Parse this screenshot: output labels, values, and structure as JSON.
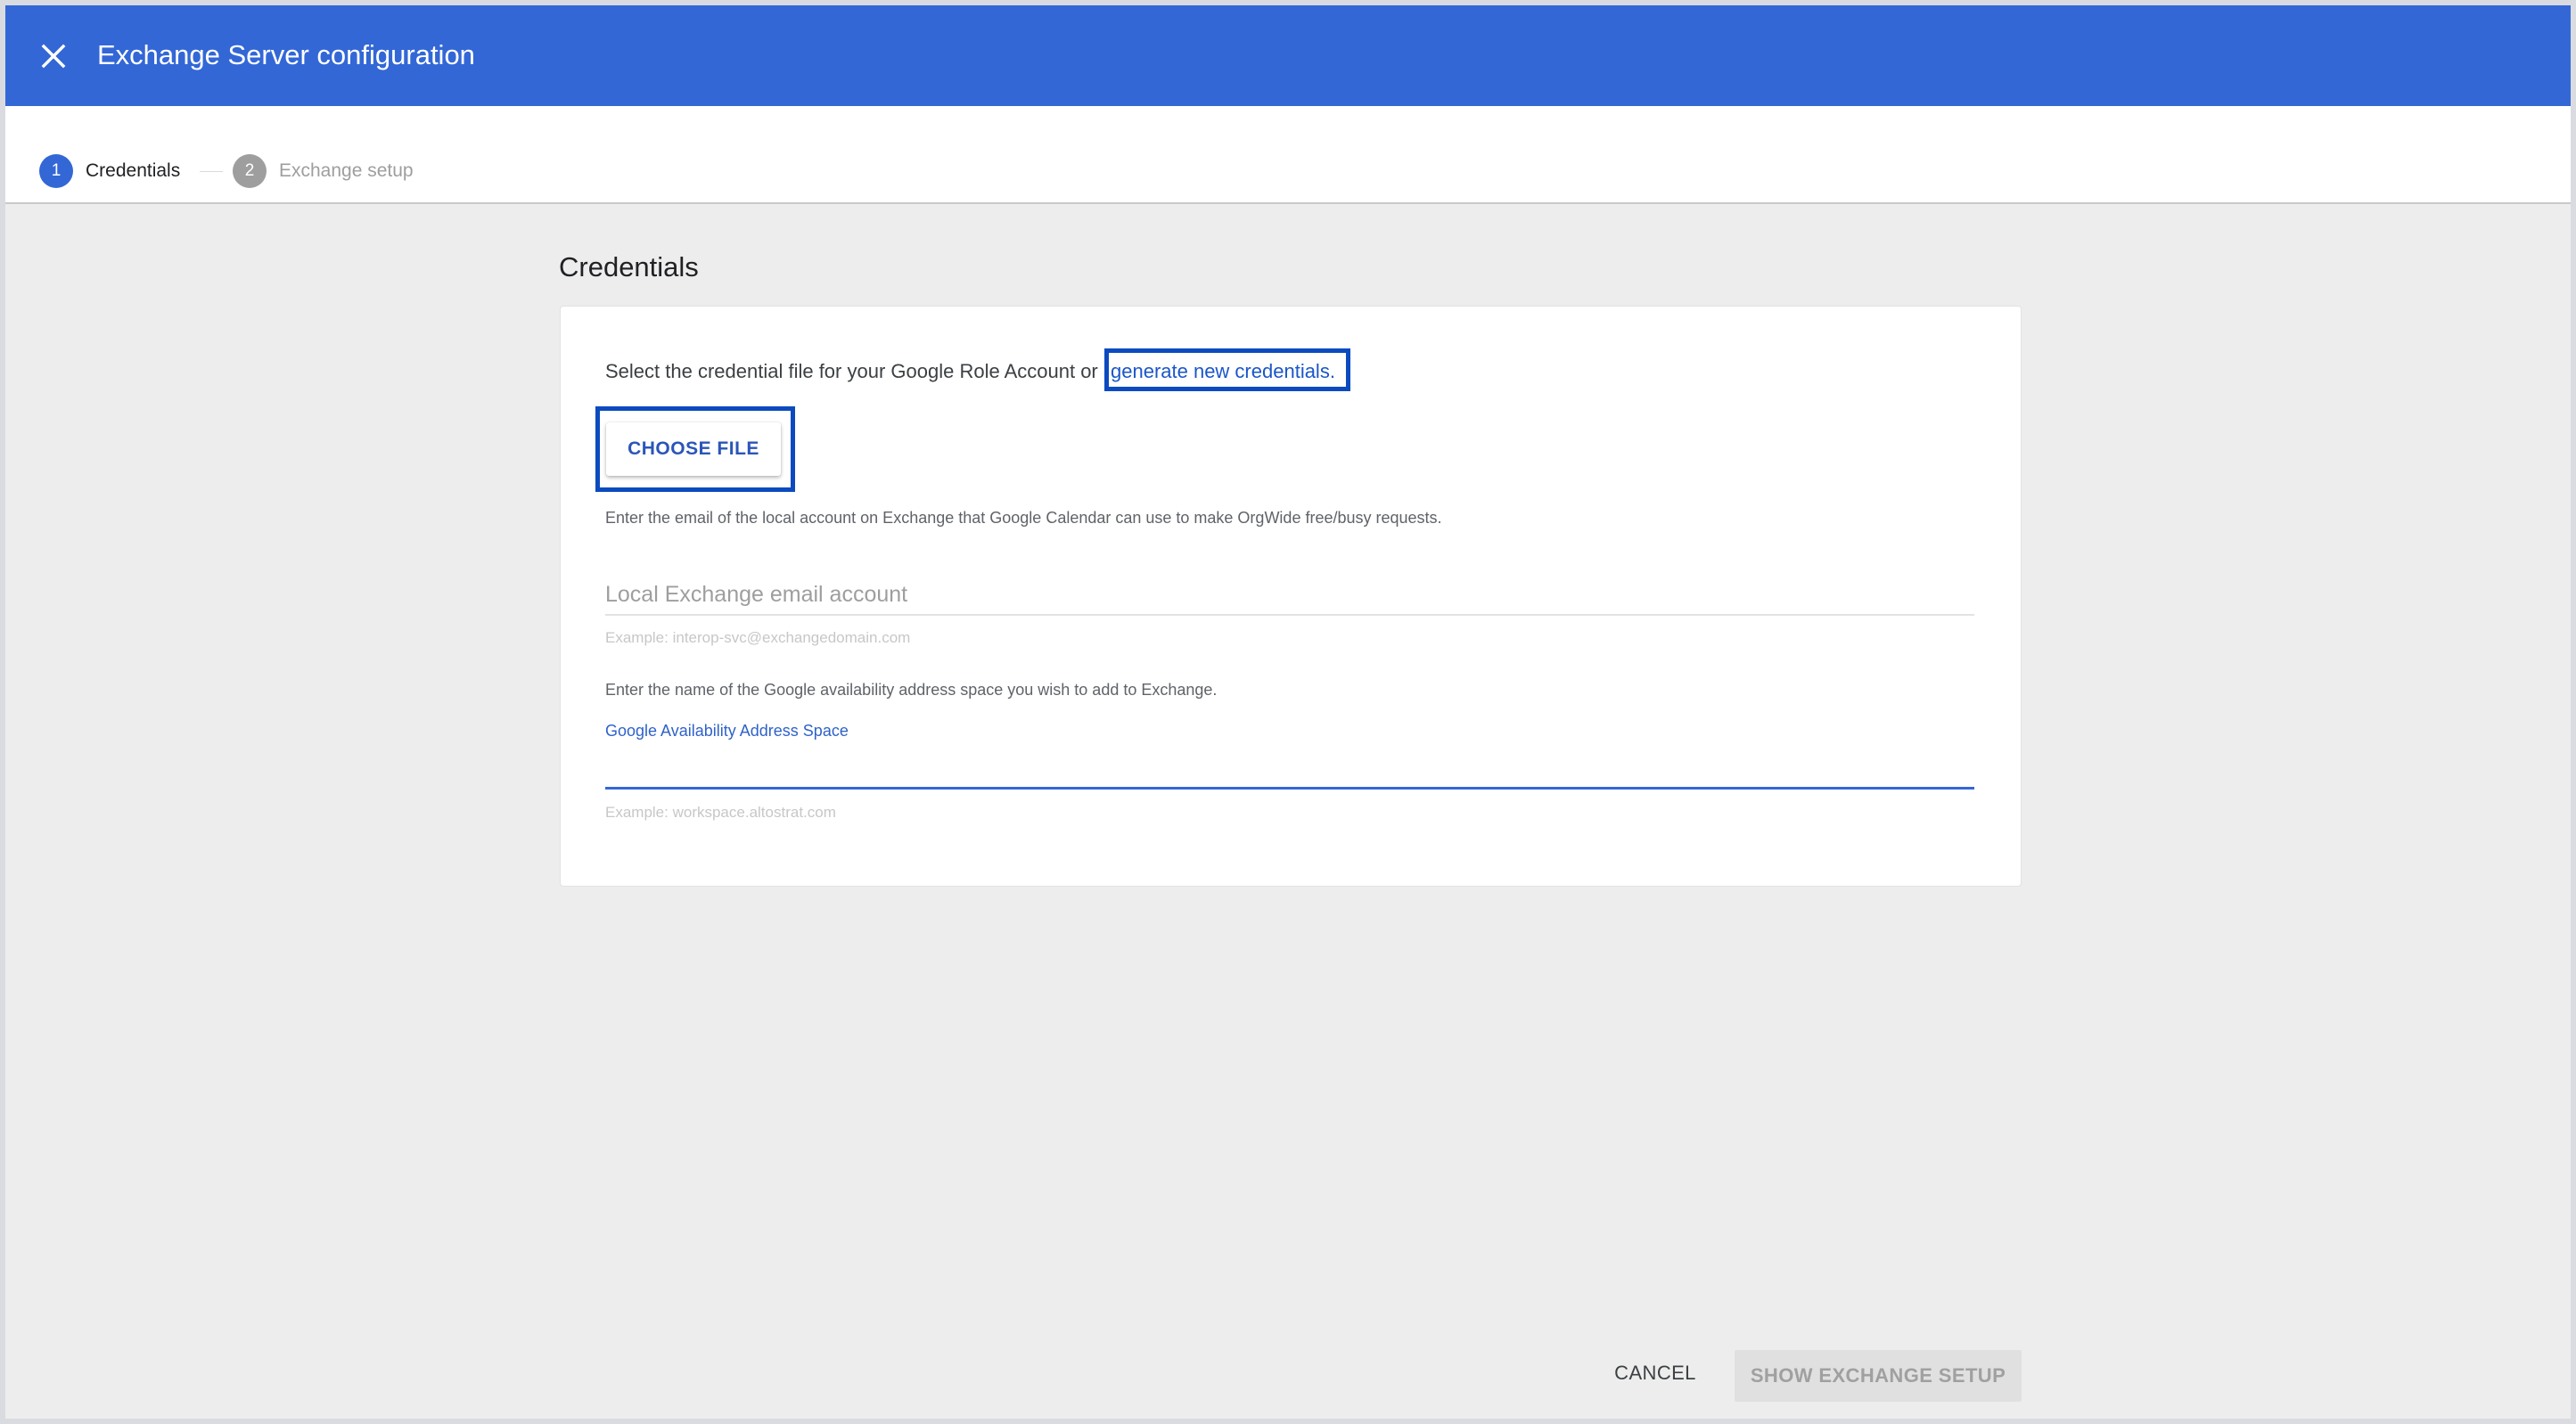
{
  "header": {
    "title": "Exchange Server configuration",
    "close_icon": "close-icon"
  },
  "stepper": {
    "steps": [
      {
        "number": "1",
        "label": "Credentials",
        "state": "active"
      },
      {
        "number": "2",
        "label": "Exchange setup",
        "state": "inactive"
      }
    ]
  },
  "main": {
    "section_title": "Credentials",
    "intro_text": "Select the credential file for your Google Role Account or",
    "intro_link": "generate new credentials.",
    "choose_file_label": "CHOOSE FILE",
    "email_help": "Enter the email of the local account on Exchange that Google Calendar can use to make OrgWide free/busy requests.",
    "email_field": {
      "placeholder": "Local Exchange email account",
      "value": "",
      "example": "Example: interop-svc@exchangedomain.com"
    },
    "space_help": "Enter the name of the Google availability address space you wish to add to Exchange.",
    "space_field": {
      "label": "Google Availability Address Space",
      "value": "",
      "example": "Example: workspace.altostrat.com"
    }
  },
  "footer": {
    "cancel_label": "CANCEL",
    "next_label": "SHOW EXCHANGE SETUP"
  },
  "colors": {
    "header_bg": "#3367d6",
    "highlight_box": "#0b4bbf",
    "link": "#1a56c9"
  }
}
